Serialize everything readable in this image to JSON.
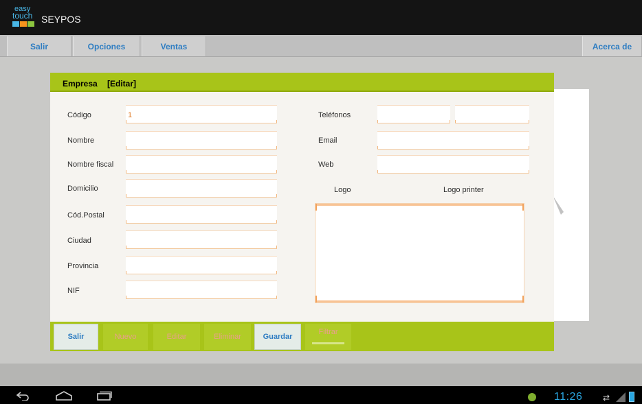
{
  "app": {
    "logo_line1": "easy",
    "logo_line2": "touch",
    "title": "SEYPOS",
    "logo_colors": [
      "#49b6e6",
      "#f7941d",
      "#8dc63f"
    ]
  },
  "menu": {
    "items": [
      {
        "label": "Salir"
      },
      {
        "label": "Opciones"
      },
      {
        "label": "Ventas"
      }
    ],
    "right_item": "Acerca de"
  },
  "dialog": {
    "title": "Empresa",
    "mode": "[Editar]",
    "left_fields": [
      {
        "label": "Código",
        "value": "1"
      },
      {
        "label": "Nombre",
        "value": ""
      },
      {
        "label": "Nombre fiscal",
        "value": ""
      },
      {
        "label": "Domicilio",
        "value": ""
      },
      {
        "label": "Cód.Postal",
        "value": ""
      },
      {
        "label": "Ciudad",
        "value": ""
      },
      {
        "label": "Provincia",
        "value": ""
      },
      {
        "label": "NIF",
        "value": ""
      }
    ],
    "phones_label": "Teléfonos",
    "phone1": "",
    "phone2": "",
    "email_label": "Email",
    "email": "",
    "web_label": "Web",
    "web": "",
    "logo_label": "Logo",
    "logo_printer_label": "Logo printer"
  },
  "toolbar": {
    "salir": "Salir",
    "nuevo": "Nuevo",
    "editar": "Editar",
    "eliminar": "Eliminar",
    "guardar": "Guardar",
    "filtrar": "Filtrar"
  },
  "status": {
    "time": "11:26"
  },
  "colors": {
    "accent_green": "#a8c419",
    "link_blue": "#2e7dc2",
    "field_orange": "#f2c79a",
    "disabled_text": "#e9a08a"
  }
}
